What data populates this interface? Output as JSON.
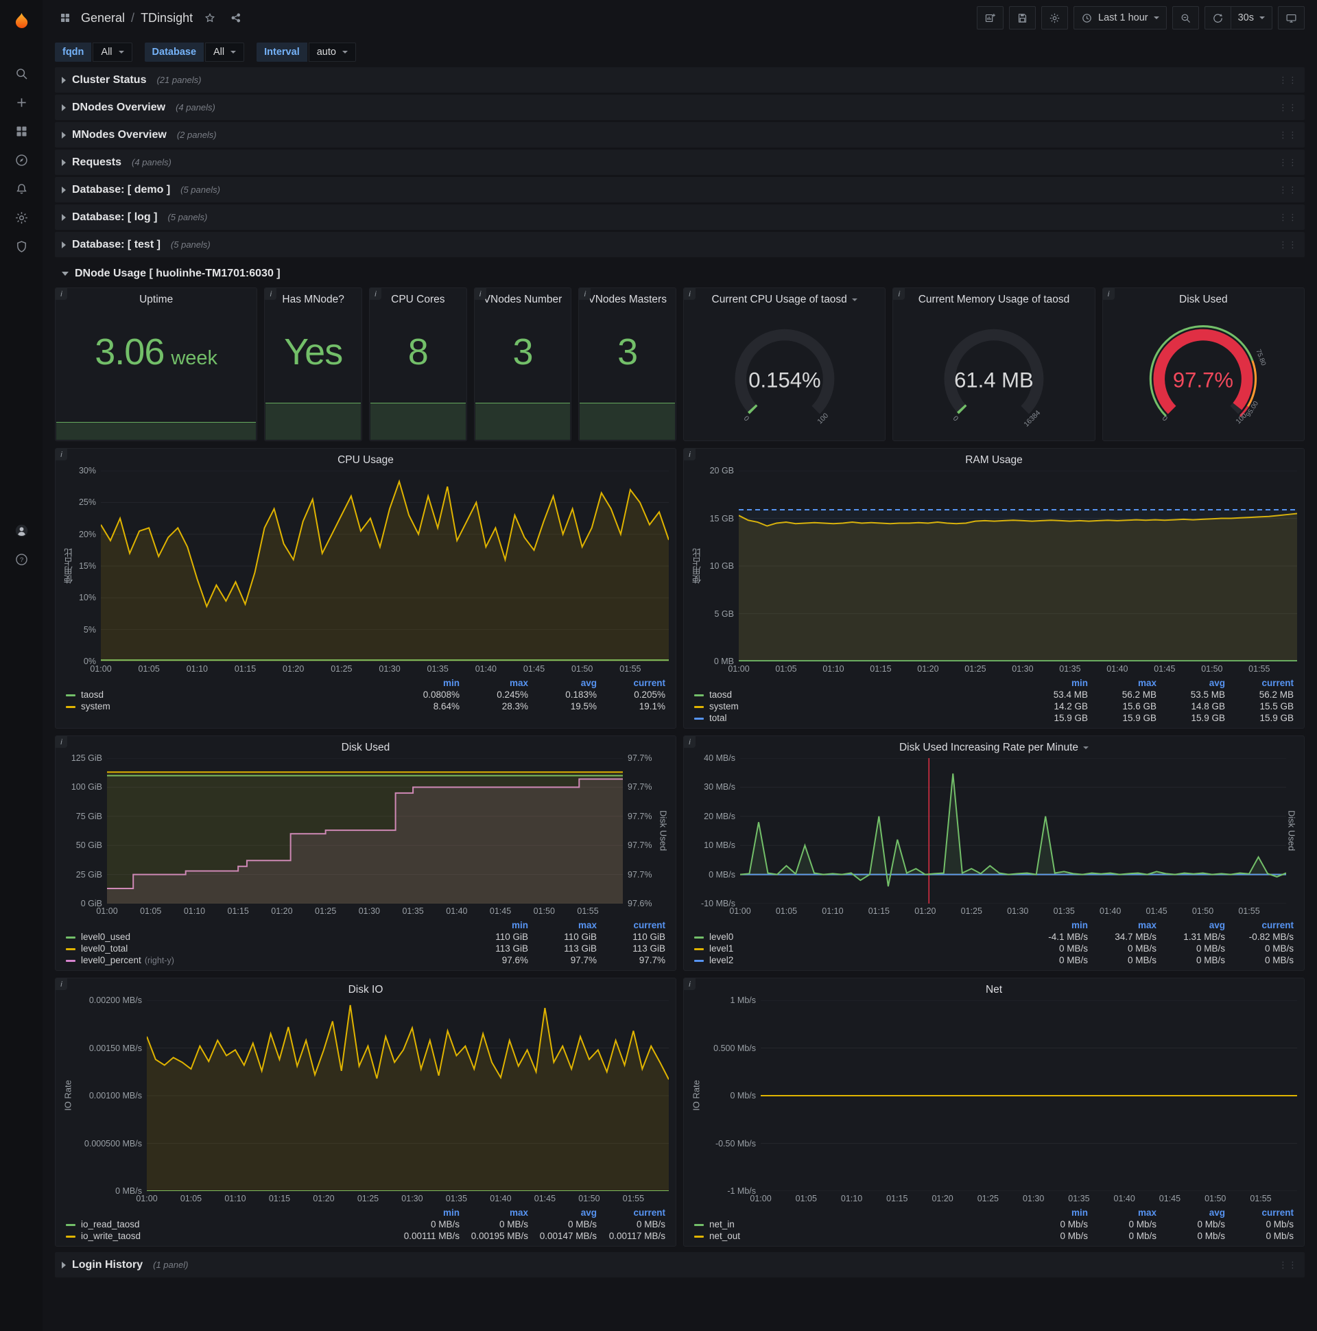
{
  "colors": {
    "stat_green": "#73bf69",
    "series_green": "#73bf69",
    "series_yellow": "#e0b400",
    "series_blue": "#5794f2",
    "series_pink": "#d683ce",
    "gauge_red": "#e02f44",
    "threshold_orange": "#ff9830",
    "annotation_red": "#e02f44",
    "legend_header_blue": "#5794f2"
  },
  "sidebar": {
    "icons": [
      "grafana-logo",
      "search",
      "add",
      "dashboards",
      "explore",
      "alerting",
      "configuration",
      "server-admin",
      "avatar",
      "help"
    ]
  },
  "header": {
    "breadcrumb_section": "General",
    "breadcrumb_separator": "/",
    "breadcrumb_title": "TDinsight",
    "time_range_label": "Last 1 hour",
    "refresh_interval_label": "30s",
    "actions": [
      "add-panel",
      "save-dashboard",
      "dashboard-settings",
      "time-range",
      "zoom-out",
      "refresh",
      "refresh-interval",
      "tv-mode"
    ]
  },
  "variables": [
    {
      "label": "fqdn",
      "value": "All"
    },
    {
      "label": "Database",
      "value": "All"
    },
    {
      "label": "Interval",
      "value": "auto"
    }
  ],
  "rows": [
    {
      "title": "Cluster Status",
      "count": "(21 panels)"
    },
    {
      "title": "DNodes Overview",
      "count": "(4 panels)"
    },
    {
      "title": "MNodes Overview",
      "count": "(2 panels)"
    },
    {
      "title": "Requests",
      "count": "(4 panels)"
    },
    {
      "title": "Database: [ demo ]",
      "count": "(5 panels)"
    },
    {
      "title": "Database: [ log ]",
      "count": "(5 panels)"
    },
    {
      "title": "Database: [ test ]",
      "count": "(5 panels)"
    }
  ],
  "expanded_row": {
    "title": "DNode Usage [ huolinhe-TM1701:6030 ]"
  },
  "footer_row": {
    "title": "Login History",
    "count": "(1 panel)"
  },
  "stats": [
    {
      "title": "Uptime",
      "value": "3.06",
      "suffix": "week"
    },
    {
      "title": "Has MNode?",
      "value": "Yes"
    },
    {
      "title": "CPU Cores",
      "value": "8"
    },
    {
      "title": "VNodes Number",
      "value": "3"
    },
    {
      "title": "VNodes Masters",
      "value": "3"
    }
  ],
  "gauges": [
    {
      "title": "Current CPU Usage of taosd",
      "has_menu_caret": true,
      "value": "0.154%",
      "min_label": "0",
      "max_label": "100",
      "fraction": 0.0015,
      "arc_color": "#73bf69",
      "value_color": "#d8d9da"
    },
    {
      "title": "Current Memory Usage of taosd",
      "has_menu_caret": false,
      "value": "61.4 MB",
      "min_label": "0",
      "max_label": "16384",
      "fraction": 0.0037,
      "arc_color": "#73bf69",
      "value_color": "#d8d9da"
    },
    {
      "title": "Disk Used",
      "has_menu_caret": false,
      "value": "97.7%",
      "min_label": "0",
      "max_label": "100",
      "fraction": 0.977,
      "arc_color": "#e02f44",
      "value_color": "#f2495c",
      "threshold_labels": [
        {
          "text": "75.80",
          "fraction": 0.758
        },
        {
          "text": "95.00",
          "fraction": 0.95
        }
      ],
      "threshold_ring": [
        {
          "to": 0.758,
          "color": "#73bf69"
        },
        {
          "to": 0.95,
          "color": "#ff9830"
        },
        {
          "to": 1,
          "color": "#e02f44"
        }
      ]
    }
  ],
  "time_axis": {
    "min": 0,
    "max": 59,
    "minutes": [
      0,
      5,
      10,
      15,
      20,
      25,
      30,
      35,
      40,
      45,
      50,
      55
    ],
    "labels": [
      "01:00",
      "01:05",
      "01:10",
      "01:15",
      "01:20",
      "01:25",
      "01:30",
      "01:35",
      "01:40",
      "01:45",
      "01:50",
      "01:55"
    ]
  },
  "chart_data": [
    {
      "type": "line",
      "title": "CPU Usage",
      "size": "tall",
      "ylabel": "使用占比",
      "left_axis": {
        "range": [
          0,
          30
        ],
        "ticks": [
          "30%",
          "25%",
          "20%",
          "15%",
          "10%",
          "5%",
          "0%"
        ]
      },
      "series": [
        {
          "name": "taosd",
          "color": "#73bf69",
          "x": [
            0,
            59
          ],
          "values": [
            0.2,
            0.2
          ]
        },
        {
          "name": "system",
          "color": "#e0b400",
          "fill": 0.12,
          "values": [
            21.5,
            19,
            22.5,
            17,
            20.5,
            21,
            16.5,
            19.5,
            21,
            18,
            13,
            8.64,
            12,
            9.5,
            12.5,
            9,
            14,
            21,
            24,
            18.5,
            16,
            22,
            25.5,
            17,
            20,
            23,
            26,
            20.5,
            22.5,
            18,
            24,
            28.3,
            23,
            20,
            26,
            21,
            27.5,
            19,
            22,
            25,
            18,
            21,
            16,
            23,
            19.5,
            17.5,
            22,
            26,
            20,
            24,
            18,
            21,
            26.5,
            24,
            20,
            27,
            25,
            21.5,
            23.5,
            19.1
          ]
        }
      ],
      "legend": {
        "columns": [
          "min",
          "max",
          "avg",
          "current"
        ],
        "rows": [
          {
            "name": "taosd",
            "color": "#73bf69",
            "values": [
              "0.0808%",
              "0.245%",
              "0.183%",
              "0.205%"
            ]
          },
          {
            "name": "system",
            "color": "#e0b400",
            "values": [
              "8.64%",
              "28.3%",
              "19.5%",
              "19.1%"
            ]
          }
        ]
      }
    },
    {
      "type": "line",
      "title": "RAM Usage",
      "size": "tall",
      "ylabel": "使用占比",
      "left_axis": {
        "range": [
          0,
          20
        ],
        "ticks": [
          "20 GB",
          "15 GB",
          "10 GB",
          "5 GB",
          "0 MB"
        ]
      },
      "series": [
        {
          "name": "system",
          "color": "#e0b400",
          "fill": 0.12,
          "values": [
            15.3,
            14.8,
            14.6,
            14.2,
            14.5,
            14.6,
            14.45,
            14.5,
            14.55,
            14.5,
            14.45,
            14.5,
            14.6,
            14.5,
            14.55,
            14.5,
            14.45,
            14.5,
            14.5,
            14.55,
            14.5,
            14.6,
            14.5,
            14.45,
            14.5,
            14.7,
            14.75,
            14.7,
            14.75,
            14.8,
            14.75,
            14.7,
            14.75,
            14.8,
            14.75,
            14.7,
            14.75,
            14.7,
            14.75,
            14.8,
            14.75,
            14.8,
            14.85,
            14.8,
            14.85,
            14.8,
            14.85,
            14.9,
            14.85,
            14.9,
            14.95,
            15.0,
            15.0,
            15.05,
            15.1,
            15.15,
            15.2,
            15.3,
            15.4,
            15.5
          ]
        },
        {
          "name": "total",
          "color": "#5794f2",
          "dash": true,
          "fill": 0.05,
          "x": [
            0,
            59
          ],
          "values": [
            15.9,
            15.9
          ]
        },
        {
          "name": "taosd",
          "color": "#73bf69",
          "x": [
            0,
            59
          ],
          "values": [
            0.053,
            0.053
          ]
        }
      ],
      "legend": {
        "columns": [
          "min",
          "max",
          "avg",
          "current"
        ],
        "rows": [
          {
            "name": "taosd",
            "color": "#73bf69",
            "values": [
              "53.4 MB",
              "56.2 MB",
              "53.5 MB",
              "56.2 MB"
            ]
          },
          {
            "name": "system",
            "color": "#e0b400",
            "values": [
              "14.2 GB",
              "15.6 GB",
              "14.8 GB",
              "15.5 GB"
            ]
          },
          {
            "name": "total",
            "color": "#5794f2",
            "values": [
              "15.9 GB",
              "15.9 GB",
              "15.9 GB",
              "15.9 GB"
            ]
          }
        ]
      }
    },
    {
      "type": "line",
      "title": "Disk Used",
      "size": "short",
      "left_axis": {
        "range": [
          0,
          125
        ],
        "ticks": [
          "125 GiB",
          "100 GiB",
          "75 GiB",
          "50 GiB",
          "25 GiB",
          "0 GiB"
        ]
      },
      "right_axis": {
        "range": [
          97.6,
          97.725
        ],
        "ticks": [
          "97.7%",
          "97.7%",
          "97.7%",
          "97.7%",
          "97.7%",
          "97.6%"
        ],
        "label": "Disk Used"
      },
      "series": [
        {
          "name": "level0_percent",
          "color": "#d683ce",
          "axis": "right",
          "fill": 0.13,
          "x": [
            0,
            3,
            3,
            9,
            9,
            15,
            15,
            16,
            16,
            21,
            21,
            25,
            25,
            33,
            33,
            35,
            35,
            54,
            54,
            59
          ],
          "values": [
            97.613,
            97.613,
            97.625,
            97.625,
            97.628,
            97.628,
            97.632,
            97.632,
            97.637,
            97.637,
            97.66,
            97.66,
            97.663,
            97.663,
            97.695,
            97.695,
            97.7,
            97.7,
            97.707,
            97.707
          ]
        },
        {
          "name": "level0_used",
          "color": "#73bf69",
          "fill": 0.07,
          "x": [
            0,
            59
          ],
          "values": [
            110,
            110
          ]
        },
        {
          "name": "level0_total",
          "color": "#e0b400",
          "fill": 0.08,
          "x": [
            0,
            59
          ],
          "values": [
            113,
            113
          ]
        }
      ],
      "legend": {
        "columns": [
          "min",
          "max",
          "current"
        ],
        "rows": [
          {
            "name": "level0_used",
            "color": "#73bf69",
            "values": [
              "110 GiB",
              "110 GiB",
              "110 GiB"
            ]
          },
          {
            "name": "level0_total",
            "color": "#e0b400",
            "values": [
              "113 GiB",
              "113 GiB",
              "113 GiB"
            ]
          },
          {
            "name": "level0_percent",
            "note": "(right-y)",
            "color": "#d683ce",
            "values": [
              "97.6%",
              "97.7%",
              "97.7%"
            ]
          }
        ]
      }
    },
    {
      "type": "line",
      "title": "Disk Used Increasing Rate per Minute",
      "size": "short",
      "has_menu_caret": true,
      "ylabel_right": "Disk Used",
      "left_axis": {
        "range": [
          -10,
          40
        ],
        "ticks": [
          "40 MB/s",
          "30 MB/s",
          "20 MB/s",
          "10 MB/s",
          "0 MB/s",
          "-10 MB/s"
        ]
      },
      "annotations": [
        {
          "x": 20.4,
          "color": "#e02f44"
        }
      ],
      "series": [
        {
          "name": "level1",
          "color": "#e0b400",
          "x": [
            0,
            59
          ],
          "values": [
            0,
            0
          ]
        },
        {
          "name": "level2",
          "color": "#5794f2",
          "x": [
            0,
            59
          ],
          "values": [
            0,
            0
          ]
        },
        {
          "name": "level0",
          "color": "#73bf69",
          "fill": 0.12,
          "values": [
            0,
            0.3,
            18,
            0.5,
            0,
            3,
            0.2,
            10,
            0.5,
            0,
            0.3,
            0,
            0.5,
            -2,
            0,
            20,
            -4.1,
            12,
            0.5,
            2,
            0,
            0.3,
            0.5,
            34.7,
            0.5,
            2,
            0.3,
            3,
            0.5,
            0,
            0.3,
            0.5,
            0,
            20,
            0.5,
            1,
            0.3,
            0,
            0.5,
            0.2,
            0.5,
            0,
            0.3,
            0.5,
            0,
            1,
            0.3,
            0,
            0.5,
            0.2,
            0.5,
            0,
            0.3,
            0,
            0.5,
            0.2,
            6,
            0.3,
            -0.82,
            0.5
          ]
        }
      ],
      "legend": {
        "columns": [
          "min",
          "max",
          "avg",
          "current"
        ],
        "rows": [
          {
            "name": "level0",
            "color": "#73bf69",
            "values": [
              "-4.1 MB/s",
              "34.7 MB/s",
              "1.31 MB/s",
              "-0.82 MB/s"
            ]
          },
          {
            "name": "level1",
            "color": "#e0b400",
            "values": [
              "0 MB/s",
              "0 MB/s",
              "0 MB/s",
              "0 MB/s"
            ]
          },
          {
            "name": "level2",
            "color": "#5794f2",
            "values": [
              "0 MB/s",
              "0 MB/s",
              "0 MB/s",
              "0 MB/s"
            ]
          }
        ]
      }
    },
    {
      "type": "line",
      "title": "Disk IO",
      "size": "tall",
      "ylabel": "IO Rate",
      "left_axis": {
        "range": [
          0,
          0.002
        ],
        "ticks": [
          "0.00200 MB/s",
          "0.00150 MB/s",
          "0.00100 MB/s",
          "0.000500 MB/s",
          "0 MB/s"
        ]
      },
      "series": [
        {
          "name": "io_read_taosd",
          "color": "#73bf69",
          "x": [
            0,
            59
          ],
          "values": [
            0,
            0
          ]
        },
        {
          "name": "io_write_taosd",
          "color": "#e0b400",
          "fill": 0.12,
          "values": [
            0.00162,
            0.00138,
            0.00132,
            0.0014,
            0.00135,
            0.00128,
            0.00152,
            0.00136,
            0.00158,
            0.00142,
            0.00148,
            0.00132,
            0.00155,
            0.00126,
            0.00165,
            0.00138,
            0.00172,
            0.00131,
            0.00158,
            0.00122,
            0.00148,
            0.00178,
            0.00126,
            0.00195,
            0.00131,
            0.00152,
            0.00118,
            0.00162,
            0.00135,
            0.00148,
            0.00171,
            0.00128,
            0.00158,
            0.00121,
            0.00168,
            0.00142,
            0.00152,
            0.00128,
            0.00165,
            0.00135,
            0.00119,
            0.00158,
            0.00131,
            0.00148,
            0.00125,
            0.00192,
            0.00135,
            0.00152,
            0.00128,
            0.00162,
            0.00138,
            0.00148,
            0.00125,
            0.00158,
            0.00132,
            0.00168,
            0.00128,
            0.00152,
            0.00135,
            0.00117
          ]
        }
      ],
      "legend": {
        "columns": [
          "min",
          "max",
          "avg",
          "current"
        ],
        "rows": [
          {
            "name": "io_read_taosd",
            "color": "#73bf69",
            "values": [
              "0 MB/s",
              "0 MB/s",
              "0 MB/s",
              "0 MB/s"
            ]
          },
          {
            "name": "io_write_taosd",
            "color": "#e0b400",
            "values": [
              "0.00111 MB/s",
              "0.00195 MB/s",
              "0.00147 MB/s",
              "0.00117 MB/s"
            ]
          }
        ]
      }
    },
    {
      "type": "line",
      "title": "Net",
      "size": "tall",
      "ylabel": "IO Rate",
      "left_axis": {
        "range": [
          -1,
          1
        ],
        "ticks": [
          "1 Mb/s",
          "0.500 Mb/s",
          "0 Mb/s",
          "-0.50 Mb/s",
          "-1 Mb/s"
        ]
      },
      "series": [
        {
          "name": "net_in",
          "color": "#73bf69",
          "x": [
            0,
            59
          ],
          "values": [
            0,
            0
          ]
        },
        {
          "name": "net_out",
          "color": "#e0b400",
          "x": [
            0,
            59
          ],
          "values": [
            0,
            0
          ]
        }
      ],
      "legend": {
        "columns": [
          "min",
          "max",
          "avg",
          "current"
        ],
        "rows": [
          {
            "name": "net_in",
            "color": "#73bf69",
            "values": [
              "0 Mb/s",
              "0 Mb/s",
              "0 Mb/s",
              "0 Mb/s"
            ]
          },
          {
            "name": "net_out",
            "color": "#e0b400",
            "values": [
              "0 Mb/s",
              "0 Mb/s",
              "0 Mb/s",
              "0 Mb/s"
            ]
          }
        ]
      }
    }
  ]
}
